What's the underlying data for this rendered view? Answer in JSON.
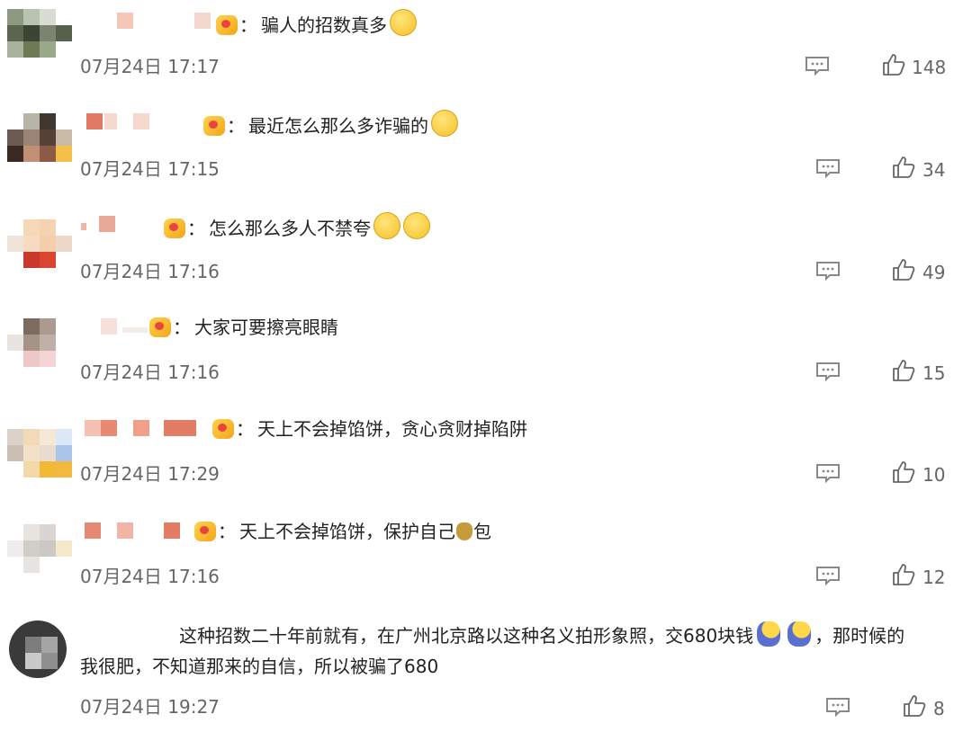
{
  "comments": [
    {
      "text": "骗人的招数真多",
      "time": "07月24日 17:17",
      "likes": "148"
    },
    {
      "text": "最近怎么那么多诈骗的",
      "time": "07月24日 17:15",
      "likes": "34"
    },
    {
      "text": "怎么那么多人不禁夸",
      "time": "07月24日 17:16",
      "likes": "49"
    },
    {
      "text": "大家可要擦亮眼睛",
      "time": "07月24日 17:16",
      "likes": "15"
    },
    {
      "text": "天上不会掉馅饼，贪心贪财掉陷阱",
      "time": "07月24日 17:29",
      "likes": "10"
    },
    {
      "text_a": "天上不会掉馅饼，保护自己",
      "text_b": "包",
      "time": "07月24日 17:16",
      "likes": "12"
    },
    {
      "text_a": "这种招数二十年前就有，在广州北京路以这种名义拍形象照，交680块钱",
      "text_b": "，那时候的",
      "text_c": "我很肥，不知道那来的自信，所以被骗了680",
      "time": "07月24日 19:27",
      "likes": "8"
    }
  ],
  "colon": "："
}
